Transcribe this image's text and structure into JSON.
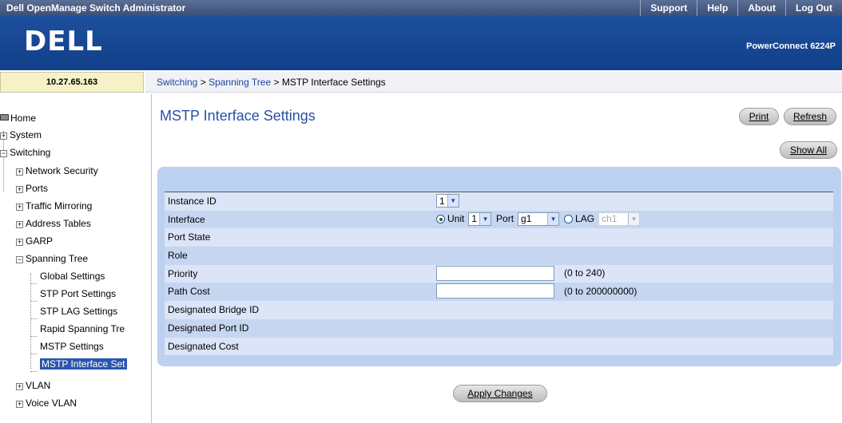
{
  "header": {
    "app_title": "Dell OpenManage Switch Administrator",
    "links": [
      "Support",
      "Help",
      "About",
      "Log Out"
    ],
    "logo": "DELL",
    "model": "PowerConnect 6224P"
  },
  "ip_address": "10.27.65.163",
  "breadcrumb": {
    "parts": [
      "Switching",
      "Spanning Tree",
      "MSTP Interface Settings"
    ],
    "separator": ">"
  },
  "sidebar": {
    "items": [
      {
        "label": "Home",
        "level": 0,
        "icon": "home-icon"
      },
      {
        "label": "System",
        "level": 0,
        "icon": "expand-icon"
      },
      {
        "label": "Switching",
        "level": 0,
        "icon": "collapse-icon"
      },
      {
        "label": "Network Security",
        "level": 1,
        "icon": "expand-icon"
      },
      {
        "label": "Ports",
        "level": 1,
        "icon": "expand-icon"
      },
      {
        "label": "Traffic Mirroring",
        "level": 1,
        "icon": "expand-icon"
      },
      {
        "label": "Address Tables",
        "level": 1,
        "icon": "expand-icon"
      },
      {
        "label": "GARP",
        "level": 1,
        "icon": "expand-icon"
      },
      {
        "label": "Spanning Tree",
        "level": 1,
        "icon": "collapse-icon"
      },
      {
        "label": "Global Settings",
        "level": 2
      },
      {
        "label": "STP Port Settings",
        "level": 2
      },
      {
        "label": "STP LAG Settings",
        "level": 2
      },
      {
        "label": "Rapid Spanning Tre",
        "level": 2
      },
      {
        "label": "MSTP Settings",
        "level": 2
      },
      {
        "label": "MSTP Interface Set",
        "level": 2,
        "selected": true
      },
      {
        "label": "VLAN",
        "level": 1,
        "icon": "expand-icon"
      },
      {
        "label": "Voice VLAN",
        "level": 1,
        "icon": "expand-icon"
      }
    ]
  },
  "main": {
    "title": "MSTP Interface Settings",
    "buttons": {
      "print": "Print",
      "refresh": "Refresh",
      "show_all": "Show All",
      "apply": "Apply Changes"
    },
    "rows": {
      "instance_id": {
        "label": "Instance ID",
        "value": "1"
      },
      "interface": {
        "label": "Interface",
        "unit_label": "Unit",
        "unit_value": "1",
        "port_label": "Port",
        "port_value": "g1",
        "lag_label": "LAG",
        "lag_value": "ch1",
        "selected": "Unit"
      },
      "port_state": {
        "label": "Port State"
      },
      "role": {
        "label": "Role"
      },
      "priority": {
        "label": "Priority",
        "value": "",
        "hint": "(0 to 240)"
      },
      "path_cost": {
        "label": "Path Cost",
        "value": "",
        "hint": "(0 to 200000000)"
      },
      "designated_bridge_id": {
        "label": "Designated Bridge ID"
      },
      "designated_port_id": {
        "label": "Designated Port ID"
      },
      "designated_cost": {
        "label": "Designated Cost"
      }
    }
  }
}
